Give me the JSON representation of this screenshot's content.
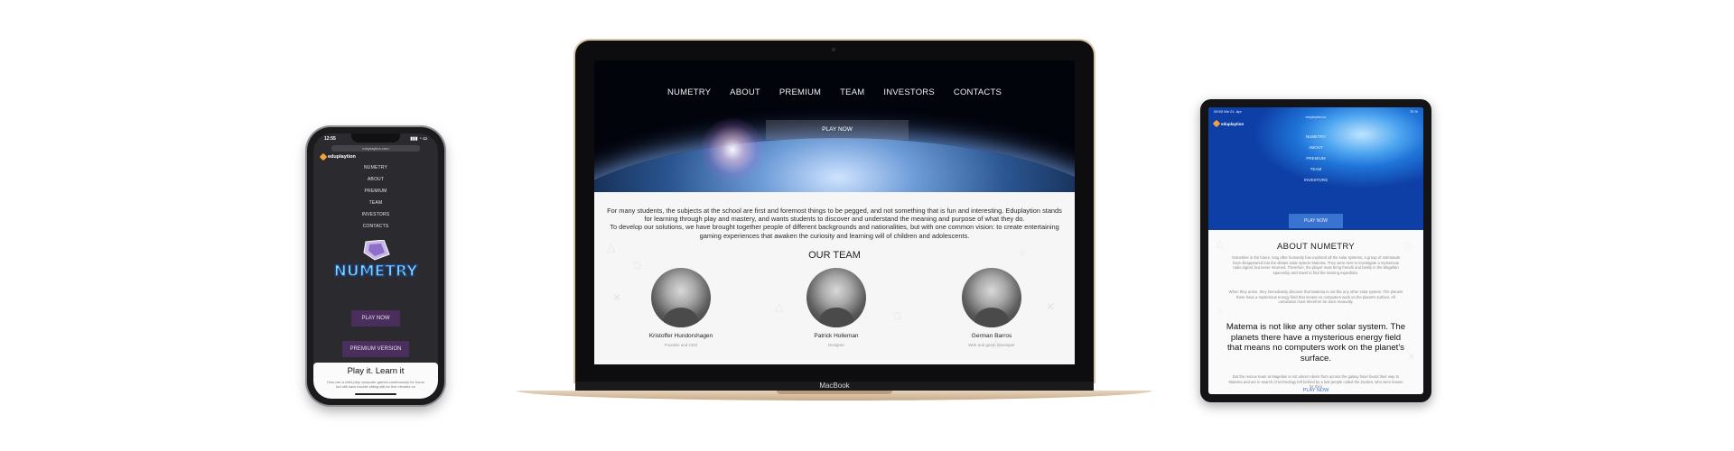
{
  "phone": {
    "status_time": "12:55",
    "url": "eduplaytion.com",
    "logo_text": "eduplaytion",
    "nav": [
      "NUMETRY",
      "ABOUT",
      "PREMIUM",
      "TEAM",
      "INVESTORS",
      "CONTACTS"
    ],
    "game_logo": "NUMETRY",
    "play_button": "PLAY NOW",
    "premium_button": "PREMIUM VERSION",
    "card_title": "Play it. Learn it",
    "card_text": "How can a child play computer games continuously for hours but still have trouble sitting still for five minutes on"
  },
  "laptop": {
    "nav": [
      "NUMETRY",
      "ABOUT",
      "PREMIUM",
      "TEAM",
      "INVESTORS",
      "CONTACTS"
    ],
    "play_button": "PLAY NOW",
    "intro_1": "For many students, the subjects at the school are first and foremost things to be pegged, and not something that is fun and interesting. Eduplaytion stands for learning through play and mastery, and wants students to discover and understand the meaning and purpose of what they do.",
    "intro_2": "To develop our solutions, we have brought together people of different backgrounds and nationalities, but with one common vision: to create entertaining gaming experiences that awaken the curiosity and learning will of children and adolescents.",
    "team_title": "OUR TEAM",
    "team": [
      {
        "name": "Kristoffer Hundorshagen",
        "role": "Founder and CEO"
      },
      {
        "name": "Patrick Holleman",
        "role": "Designer"
      },
      {
        "name": "German Barros",
        "role": "Web and game developer"
      }
    ],
    "brand_label": "MacBook"
  },
  "tablet": {
    "status_left": "09:50  We 21. Apr",
    "status_right": "75 %",
    "url": "eduplaytion.no",
    "logo_text": "eduplaytion",
    "nav": [
      "NUMETRY",
      "ABOUT",
      "PREMIUM",
      "TEAM",
      "INVESTORS"
    ],
    "play_button": "PLAY NOW",
    "about_title": "ABOUT NUMETRY",
    "about_p1": "Sometime in the future, long after humanity has explored all the solar systems, a group of astronauts have disappeared into the distant solar system Matema. They were sent to investigate a mysterious radio signal, but never returned. Therefore, the player must bring friends and family in the Magellan spaceship and travel to find the missing expedition.",
    "about_p2": "When they arrive, they immediately discover that Matema is not like any other solar system. The planets there have a mysterious energy field that means no computers work on the planet's surface. All calculation must therefore be done manually.",
    "quote": "Matema is not like any other solar system. The planets there have a mysterious energy field that means no computers work on the planet's surface.",
    "about_p3": "But the rescue team at Magellan is not alone! Aliens from across the galaxy have found their way to Matema and are in search of technology left behind by a lost people called the Zuxites, who were known for their",
    "play_link": "PLAY NOW"
  }
}
